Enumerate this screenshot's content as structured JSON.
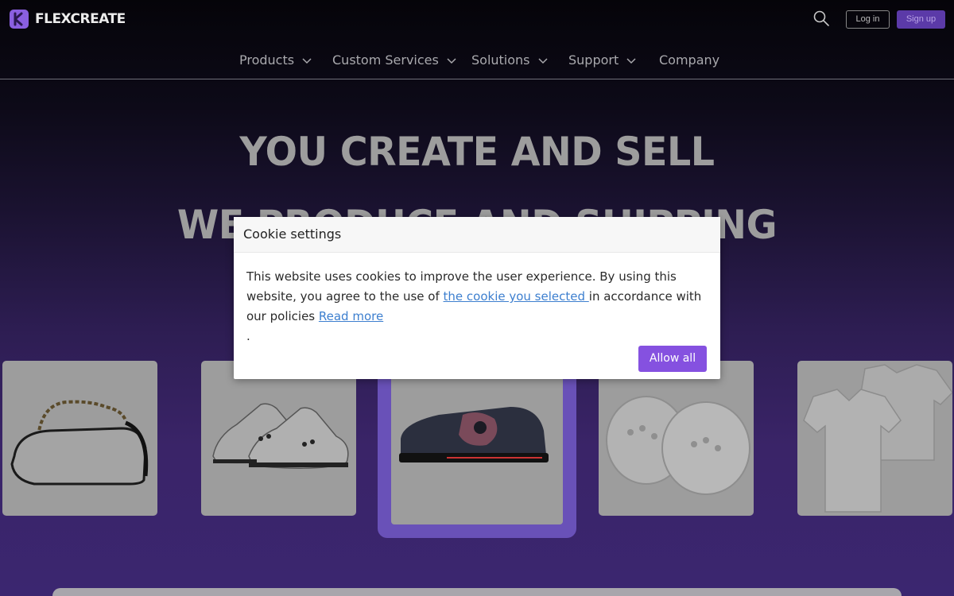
{
  "header": {
    "brand_name": "FLEXCREATE",
    "login_label": "Log in",
    "signup_label": "Sign up",
    "icons": {
      "search": "search-icon",
      "logo": "flexcreate-logo-icon"
    },
    "colors": {
      "brand": "#8a5fe0",
      "signup_bg": "#5b3aa8"
    }
  },
  "nav": {
    "items": [
      {
        "label": "Products",
        "has_dropdown": true
      },
      {
        "label": "Custom Services",
        "has_dropdown": true
      },
      {
        "label": "Solutions",
        "has_dropdown": true
      },
      {
        "label": "Support",
        "has_dropdown": true
      },
      {
        "label": "Company",
        "has_dropdown": false
      }
    ]
  },
  "hero": {
    "line1": "YOU CREATE AND SELL",
    "line2": "WE PRODUCE AND SHIPPING"
  },
  "products": [
    {
      "name": "handbag"
    },
    {
      "name": "sneakers"
    },
    {
      "name": "slip-on-shoe",
      "featured": true
    },
    {
      "name": "clogs"
    },
    {
      "name": "shirts"
    }
  ],
  "cookie": {
    "title": "Cookie settings",
    "text_before": "This website uses cookies to improve the user experience. By using this website, you agree to the use of ",
    "link_selected": "the cookie you selected ",
    "text_middle": "in accordance with our policies ",
    "link_read_more": "Read more",
    "text_end": ".",
    "allow_label": "Allow all",
    "colors": {
      "button": "#8551e0",
      "link": "#3d7fcf"
    }
  }
}
